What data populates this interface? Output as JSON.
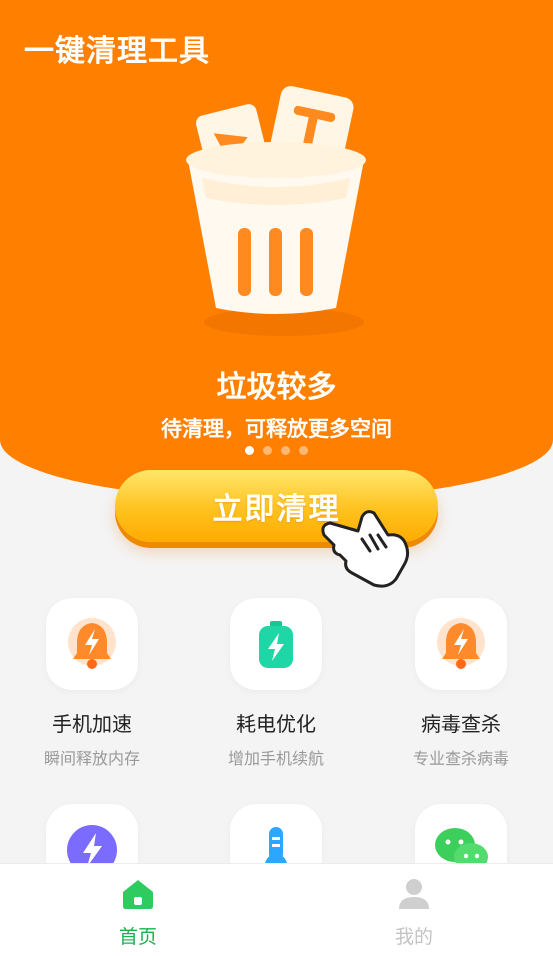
{
  "app": {
    "title": "一键清理工具"
  },
  "hero": {
    "headline": "垃圾较多",
    "subline": "待清理，可释放更多空间",
    "dots_total": 4,
    "dots_active_index": 0,
    "trash_icon": "trash-can-icon",
    "background": "#ff7f00"
  },
  "clean_button": {
    "label": "立即清理",
    "icon": "pointing-hand-icon"
  },
  "features": [
    {
      "name": "手机加速",
      "desc": "瞬间释放内存",
      "icon": "bell-lightning-icon",
      "color": "#ff8a2b"
    },
    {
      "name": "耗电优化",
      "desc": "增加手机续航",
      "icon": "battery-charge-icon",
      "color": "#1fd6a6"
    },
    {
      "name": "病毒查杀",
      "desc": "专业查杀病毒",
      "icon": "bell-lightning-icon",
      "color": "#ff8a2b"
    },
    {
      "icon": "lightning-circle-icon",
      "color": "#7b6cff"
    },
    {
      "icon": "thermometer-icon",
      "color": "#2aa8ff"
    },
    {
      "icon": "wechat-icon",
      "color": "#3dcf5c"
    }
  ],
  "tabbar": {
    "home_label": "首页",
    "mine_label": "我的",
    "active_color": "#19b24f"
  }
}
